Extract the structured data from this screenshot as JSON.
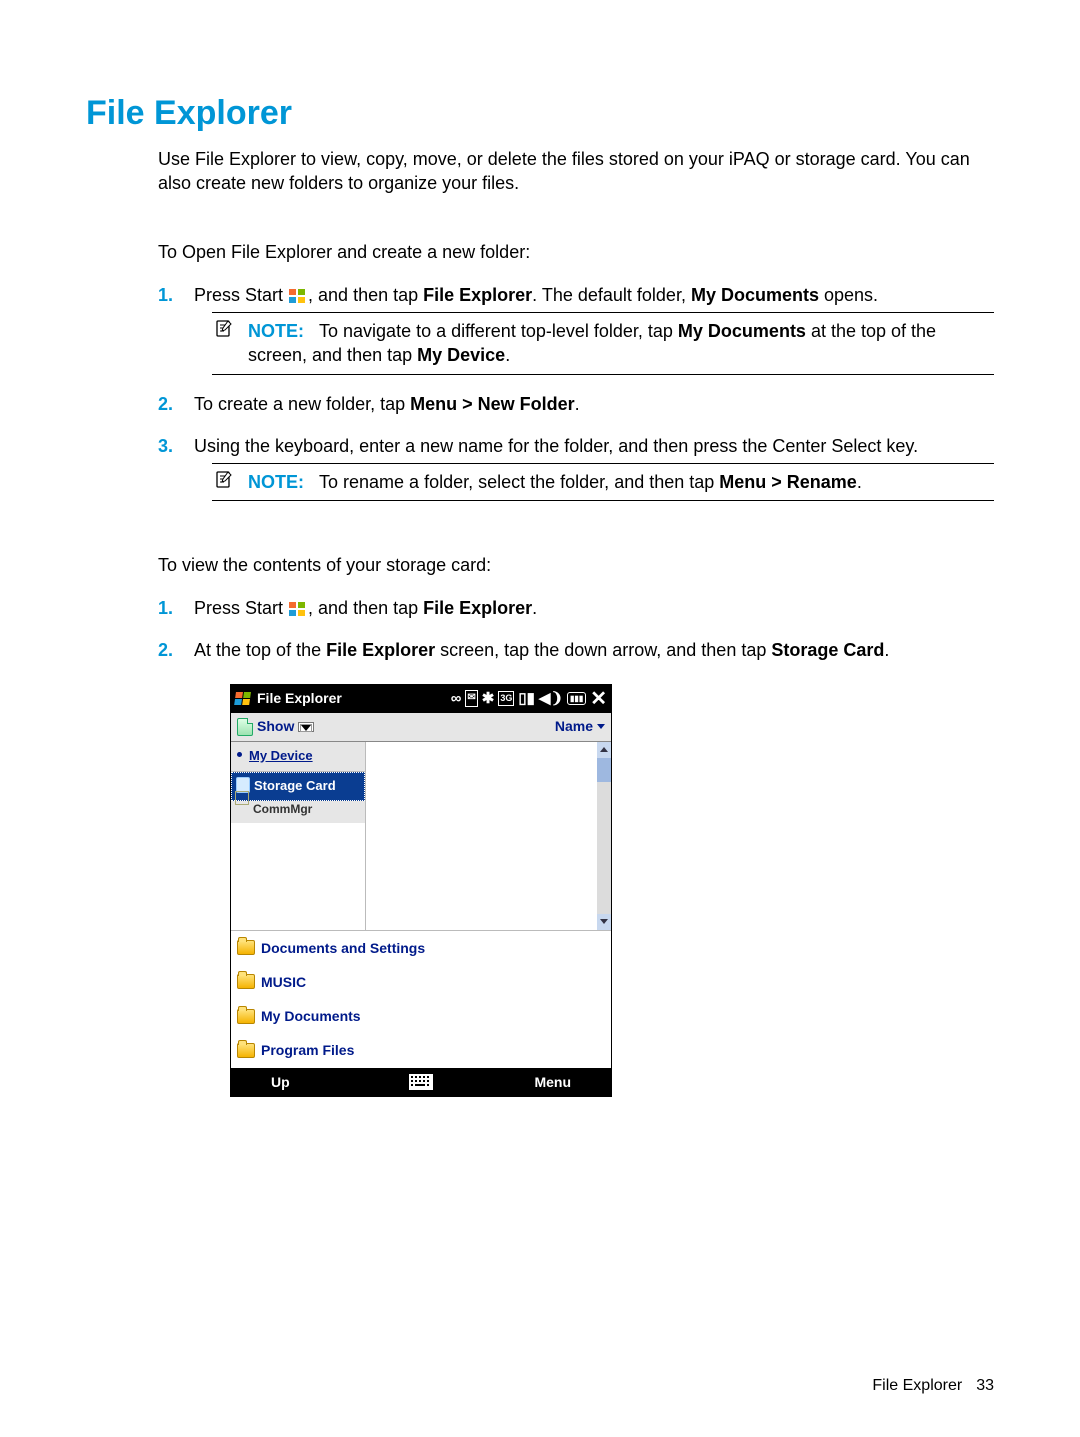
{
  "heading": "File Explorer",
  "intro": "Use File Explorer to view, copy, move, or delete the files stored on your iPAQ or storage card. You can also create new folders to organize your files.",
  "section1": {
    "lead": "To Open File Explorer and create a new folder:",
    "steps": {
      "s1_a": "Press Start ",
      "s1_b": ", and then tap ",
      "s1_c": "File Explorer",
      "s1_d": ". The default folder, ",
      "s1_e": "My Documents",
      "s1_f": " opens.",
      "note1_label": "NOTE:",
      "note1_a": "To navigate to a different top-level folder, tap ",
      "note1_b": "My Documents",
      "note1_c": " at the top of the screen, and then tap ",
      "note1_d": "My Device",
      "note1_e": ".",
      "s2_a": "To create a new folder, tap ",
      "s2_b": "Menu > New Folder",
      "s2_c": ".",
      "s3": "Using the keyboard, enter a new name for the folder, and then press the Center Select key.",
      "note2_label": "NOTE:",
      "note2_a": "To rename a folder, select the folder, and then tap ",
      "note2_b": "Menu > Rename",
      "note2_c": "."
    }
  },
  "section2": {
    "lead": "To view the contents of your storage card:",
    "steps": {
      "s1_a": "Press Start ",
      "s1_b": ", and then tap ",
      "s1_c": "File Explorer",
      "s1_d": ".",
      "s2_a": "At the top of the ",
      "s2_b": "File Explorer",
      "s2_c": " screen, tap the down arrow, and then tap ",
      "s2_d": "Storage Card",
      "s2_e": "."
    }
  },
  "device": {
    "title": "File Explorer",
    "toolbar_show": "Show",
    "toolbar_name": "Name",
    "tree_root": "My Device",
    "tree_selected": "Storage Card",
    "tree_trunc": "CommMgr",
    "files": [
      "Documents and Settings",
      "MUSIC",
      "My Documents",
      "Program Files"
    ],
    "soft_left": "Up",
    "soft_right": "Menu",
    "status_glyphs": "∞ ✉ ✱ 3G ▥ ◀❨ ▮▮▮"
  },
  "footer_label": "File Explorer",
  "footer_page": "33"
}
